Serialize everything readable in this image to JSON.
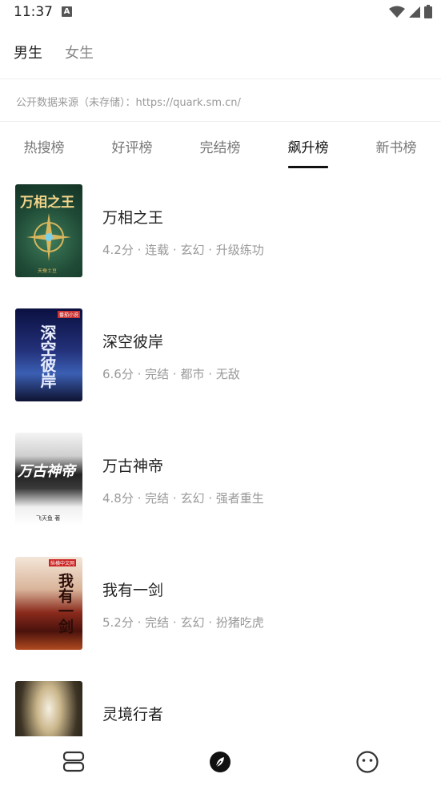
{
  "status": {
    "time": "11:37",
    "notification_glyph": "A"
  },
  "gender_tabs": [
    {
      "label": "男生",
      "active": true
    },
    {
      "label": "女生",
      "active": false
    }
  ],
  "source": "公开数据来源（未存储）：https://quark.sm.cn/",
  "rank_tabs": [
    {
      "label": "热搜榜",
      "active": false
    },
    {
      "label": "好评榜",
      "active": false
    },
    {
      "label": "完结榜",
      "active": false
    },
    {
      "label": "飙升榜",
      "active": true
    },
    {
      "label": "新书榜",
      "active": false
    }
  ],
  "books": [
    {
      "title": "万相之王",
      "meta": "4.2分 · 连载 · 玄幻 · 升级练功",
      "cover_text": "万相之王",
      "cover_author": "天蚕土豆"
    },
    {
      "title": "深空彼岸",
      "meta": "6.6分 · 完结 · 都市 · 无敌",
      "cover_text": "深空彼岸",
      "cover_badge": "番茄小说"
    },
    {
      "title": "万古神帝",
      "meta": "4.8分 · 完结 · 玄幻 · 强者重生",
      "cover_text": "万古神帝",
      "cover_author": "飞天鱼 著"
    },
    {
      "title": "我有一剑",
      "meta": "5.2分 · 完结 · 玄幻 · 扮猪吃虎",
      "cover_text": "我有一剑",
      "cover_badge": "纵横中文网"
    },
    {
      "title": "灵境行者",
      "meta": "",
      "cover_text": ""
    }
  ],
  "bottom_nav": [
    {
      "icon": "bookshelf-icon",
      "active": false
    },
    {
      "icon": "discover-compass-icon",
      "active": true
    },
    {
      "icon": "profile-face-icon",
      "active": false
    }
  ]
}
